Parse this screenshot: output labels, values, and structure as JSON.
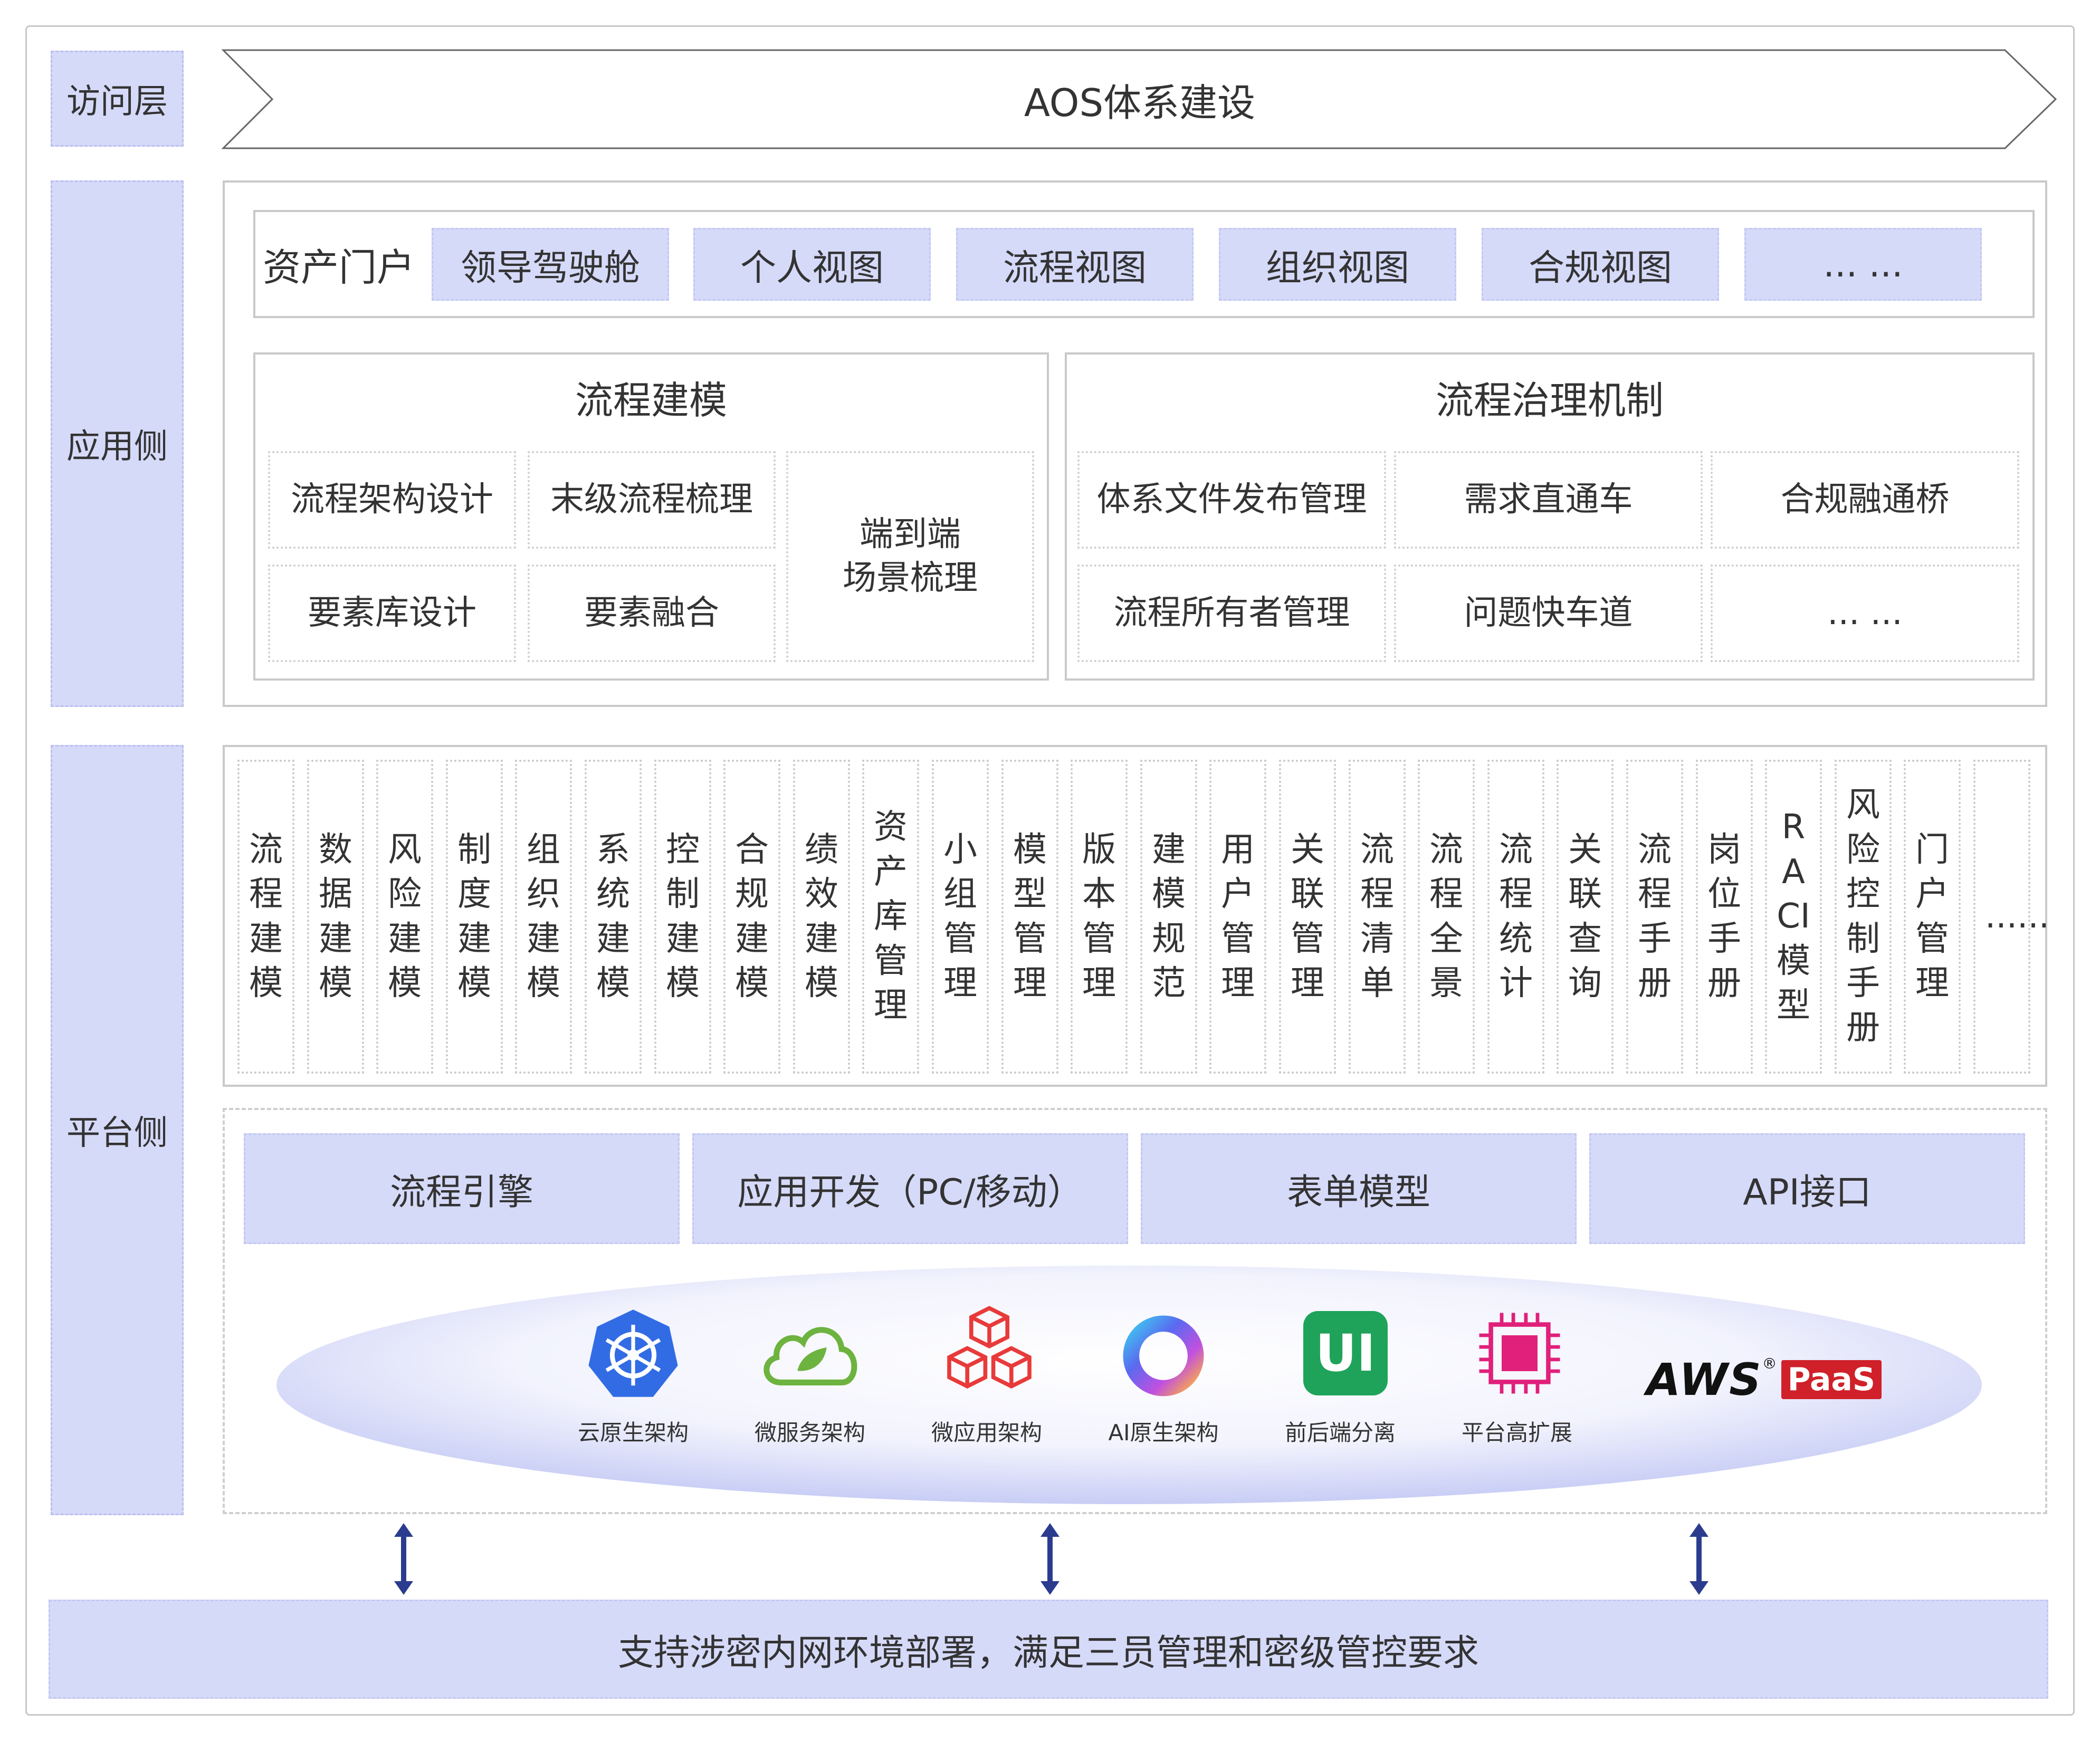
{
  "access_layer": {
    "label": "访问层",
    "banner": "AOS体系建设"
  },
  "app_layer": {
    "label": "应用侧",
    "portal": {
      "title": "资产门户",
      "chips": [
        "领导驾驶舱",
        "个人视图",
        "流程视图",
        "组织视图",
        "合规视图",
        "... ..."
      ]
    },
    "modeling": {
      "title": "流程建模",
      "items": [
        "流程架构设计",
        "末级流程梳理",
        "要素库设计",
        "要素融合"
      ],
      "scene": "端到端\n场景梳理"
    },
    "governance": {
      "title": "流程治理机制",
      "items": [
        "体系文件发布管理",
        "需求直通车",
        "合规融通桥",
        "流程所有者管理",
        "问题快车道",
        "... ..."
      ]
    }
  },
  "platform_layer": {
    "label": "平台侧",
    "modules": [
      "流程建模",
      "数据建模",
      "风险建模",
      "制度建模",
      "组织建模",
      "系统建模",
      "控制建模",
      "合规建模",
      "绩效建模",
      "资产库管理",
      "小组管理",
      "模型管理",
      "版本管理",
      "建模规范",
      "用户管理",
      "关联管理",
      "流程清单",
      "流程全景",
      "流程统计",
      "关联查询",
      "流程手册",
      "岗位手册",
      "RACI模型",
      "风险控制手册",
      "门户管理",
      "......"
    ],
    "services": [
      "流程引擎",
      "应用开发（PC/移动）",
      "表单模型",
      "API接口"
    ],
    "tech": [
      "云原生架构",
      "微服务架构",
      "微应用架构",
      "AI原生架构",
      "前后端分离",
      "平台高扩展"
    ],
    "aws_logo": {
      "text": "AWS",
      "badge": "PaaS",
      "mark": "®"
    },
    "ui_icon_text": "UI"
  },
  "footer": {
    "text": "支持涉密内网环境部署，满足三员管理和密级管控要求"
  },
  "colors": {
    "chip_fill": "#d6daf9",
    "arrow": "#2b3c8f",
    "k8s": "#326ce5",
    "spring": "#6db33f",
    "micro_app": "#e83a3a",
    "ui_green": "#1fa35a",
    "chip_pink": "#e0207a",
    "aws_red": "#d0202a"
  },
  "icons": [
    "kubernetes-icon",
    "spring-cloud-icon",
    "cubes-icon",
    "ai-ring-icon",
    "ui-icon",
    "chip-icon",
    "aws-paas-logo",
    "double-arrow-icon"
  ]
}
